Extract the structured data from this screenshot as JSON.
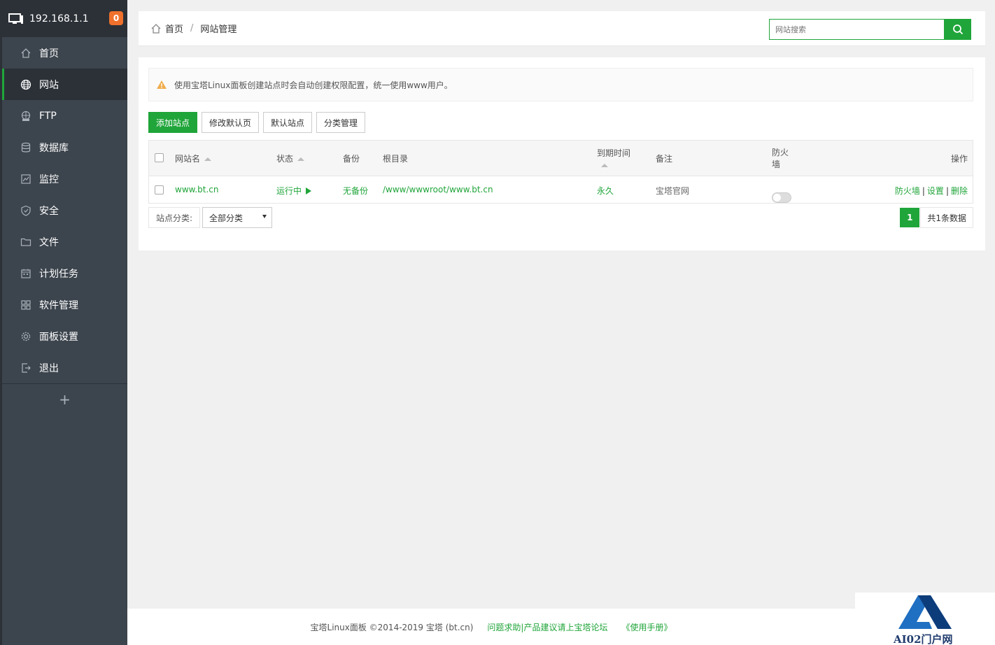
{
  "header": {
    "ip": "192.168.1.1",
    "badge": "0"
  },
  "sidebar": {
    "items": [
      {
        "label": "首页",
        "icon": "home-icon"
      },
      {
        "label": "网站",
        "icon": "globe-icon",
        "active": true
      },
      {
        "label": "FTP",
        "icon": "ftp-icon"
      },
      {
        "label": "数据库",
        "icon": "database-icon"
      },
      {
        "label": "监控",
        "icon": "monitor-chart-icon"
      },
      {
        "label": "安全",
        "icon": "shield-icon"
      },
      {
        "label": "文件",
        "icon": "folder-icon"
      },
      {
        "label": "计划任务",
        "icon": "calendar-icon"
      },
      {
        "label": "软件管理",
        "icon": "apps-grid-icon"
      },
      {
        "label": "面板设置",
        "icon": "gear-icon"
      },
      {
        "label": "退出",
        "icon": "logout-icon"
      }
    ],
    "add": "+"
  },
  "breadcrumb": {
    "home": "首页",
    "sep": "/",
    "current": "网站管理"
  },
  "search": {
    "placeholder": "网站搜索"
  },
  "notice": "使用宝塔Linux面板创建站点时会自动创建权限配置，统一使用www用户。",
  "buttons": {
    "add_site": "添加站点",
    "edit_default_page": "修改默认页",
    "default_site": "默认站点",
    "category_manage": "分类管理"
  },
  "table": {
    "headers": {
      "name": "网站名",
      "status": "状态",
      "backup": "备份",
      "root": "根目录",
      "expire": "到期时间",
      "remark": "备注",
      "firewall_line1": "防火",
      "firewall_line2": "墙",
      "ops": "操作"
    },
    "rows": [
      {
        "name": "www.bt.cn",
        "status": "运行中",
        "backup": "无备份",
        "root": "/www/wwwroot/www.bt.cn",
        "expire": "永久",
        "remark": "宝塔官网",
        "firewall_on": false,
        "op_firewall": "防火墙",
        "op_settings": "设置",
        "op_delete": "删除",
        "op_sep": "|"
      }
    ]
  },
  "category": {
    "label": "站点分类:",
    "selected": "全部分类"
  },
  "pager": {
    "page": "1",
    "total": "共1条数据"
  },
  "footer": {
    "copyright": "宝塔Linux面板 ©2014-2019 宝塔 (bt.cn)",
    "help": "问题求助|产品建议请上宝塔论坛",
    "manual": "《使用手册》"
  },
  "watermark": "AI02门户网",
  "colors": {
    "accent": "#20a53a",
    "sidebar": "#3c444d",
    "sidebar_dark": "#2c3138",
    "badge": "#f0712c",
    "warning": "#f0ad4e"
  }
}
